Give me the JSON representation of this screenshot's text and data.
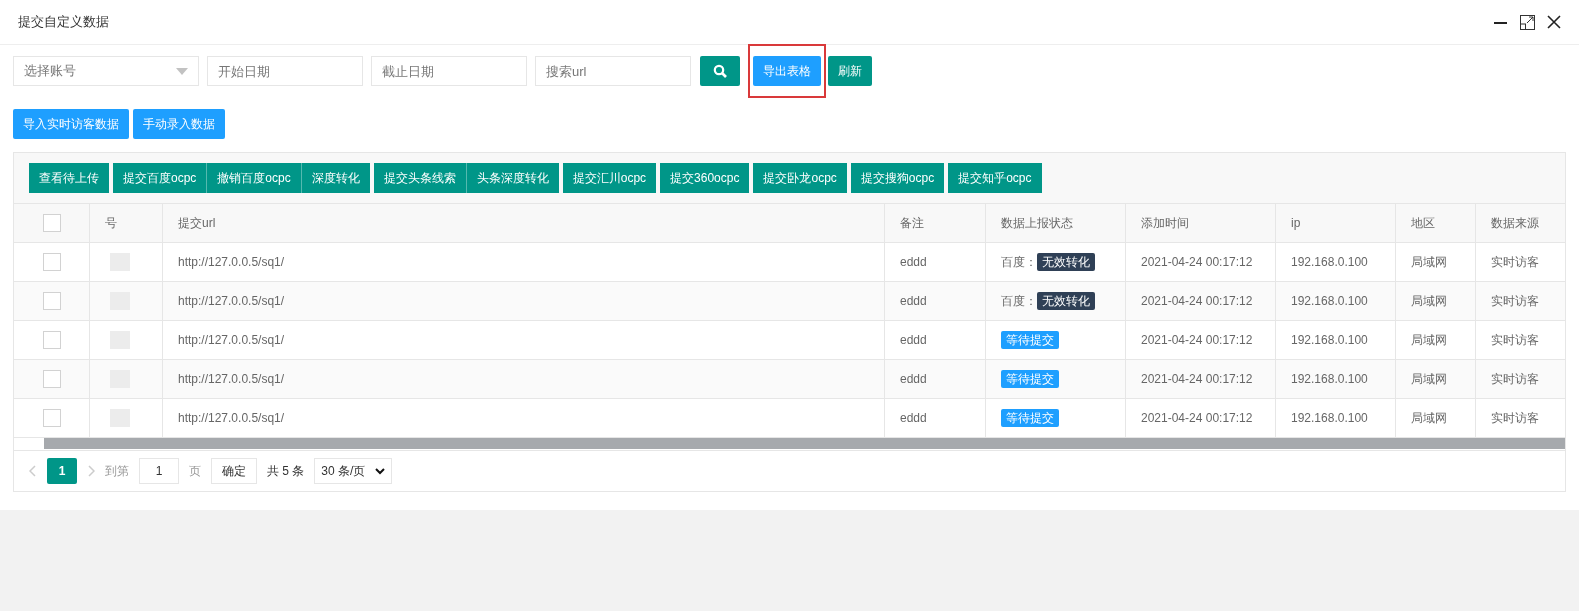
{
  "window": {
    "title": "提交自定义数据"
  },
  "filters": {
    "account": {
      "placeholder": "选择账号"
    },
    "start_date": {
      "placeholder": "开始日期"
    },
    "end_date": {
      "placeholder": "截止日期"
    },
    "url": {
      "placeholder": "搜索url"
    },
    "export_button": {
      "label": "导出表格",
      "highlighted": true
    },
    "refresh_button": "刷新"
  },
  "import_buttons": [
    "导入实时访客数据",
    "手动录入数据"
  ],
  "action_groups": [
    [
      "查看待上传"
    ],
    [
      "提交百度ocpc",
      "撤销百度ocpc",
      "深度转化"
    ],
    [
      "提交头条线索",
      "头条深度转化"
    ],
    [
      "提交汇川ocpc"
    ],
    [
      "提交360ocpc"
    ],
    [
      "提交卧龙ocpc"
    ],
    [
      "提交搜狗ocpc"
    ],
    [
      "提交知乎ocpc"
    ]
  ],
  "table": {
    "all_checked": false,
    "columns": [
      "号",
      "提交url",
      "备注",
      "数据上报状态",
      "添加时间",
      "ip",
      "地区",
      "数据来源"
    ],
    "rows": [
      {
        "checked": false,
        "url": "http://127.0.0.5/sq1/",
        "note": "eddd",
        "status": {
          "kind": "invalid",
          "prefix": "百度：",
          "label": "无效转化"
        },
        "time": "2021-04-24 00:17:12",
        "ip": "192.168.0.100",
        "region": "局域网",
        "source": "实时访客"
      },
      {
        "checked": false,
        "url": "http://127.0.0.5/sq1/",
        "note": "eddd",
        "status": {
          "kind": "invalid",
          "prefix": "百度：",
          "label": "无效转化"
        },
        "time": "2021-04-24 00:17:12",
        "ip": "192.168.0.100",
        "region": "局域网",
        "source": "实时访客"
      },
      {
        "checked": false,
        "url": "http://127.0.0.5/sq1/",
        "note": "eddd",
        "status": {
          "kind": "pending",
          "label": "等待提交"
        },
        "time": "2021-04-24 00:17:12",
        "ip": "192.168.0.100",
        "region": "局域网",
        "source": "实时访客"
      },
      {
        "checked": false,
        "url": "http://127.0.0.5/sq1/",
        "note": "eddd",
        "status": {
          "kind": "pending",
          "label": "等待提交"
        },
        "time": "2021-04-24 00:17:12",
        "ip": "192.168.0.100",
        "region": "局域网",
        "source": "实时访客"
      },
      {
        "checked": false,
        "url": "http://127.0.0.5/sq1/",
        "note": "eddd",
        "status": {
          "kind": "pending",
          "label": "等待提交"
        },
        "time": "2021-04-24 00:17:12",
        "ip": "192.168.0.100",
        "region": "局域网",
        "source": "实时访客"
      }
    ]
  },
  "pagination": {
    "pages": [
      {
        "label": "1",
        "selected": true
      }
    ],
    "goto_label": "到第",
    "page_value": "1",
    "page_unit": "页",
    "confirm": "确定",
    "total": "共 5 条",
    "page_size": "30 条/页"
  }
}
